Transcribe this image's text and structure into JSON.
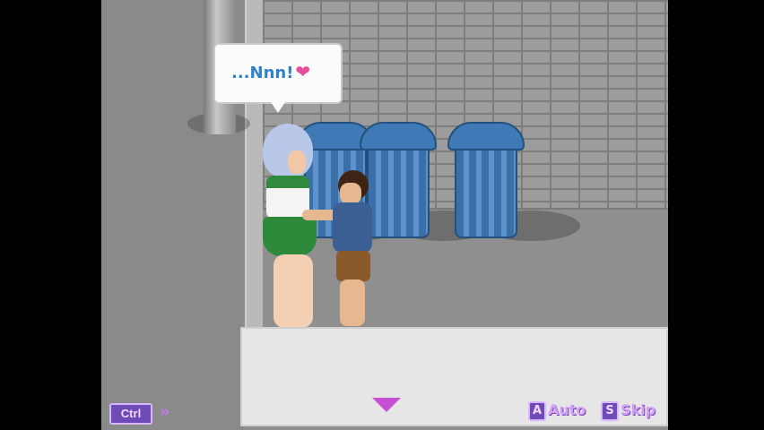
{
  "speech": {
    "text": "...Nnn!",
    "heart_icon": "heart-icon"
  },
  "controls": {
    "ctrl_label": "Ctrl",
    "fast_forward_icon": "fast-forward-icon",
    "auto_key": "A",
    "auto_label": "Auto",
    "skip_key": "S",
    "skip_label": "Skip"
  },
  "colors": {
    "accent": "#6f4bb7",
    "speech_text": "#2f82c8",
    "heart": "#e74c9a",
    "skirt": "#2d8a3b",
    "trash_can": "#3f79b6"
  }
}
